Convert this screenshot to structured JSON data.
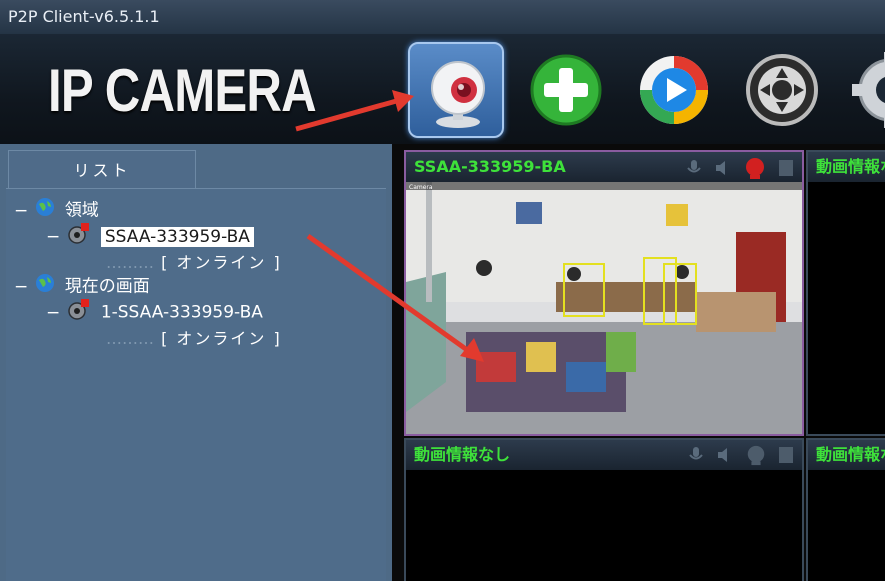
{
  "window": {
    "title": "P2P Client-v6.5.1.1"
  },
  "toolbar": {
    "logo_text": "IP CAMERA",
    "buttons": [
      {
        "icon": "webcam-icon",
        "state": "selected"
      },
      {
        "icon": "add-icon"
      },
      {
        "icon": "playback-icon"
      },
      {
        "icon": "ptz-control-icon"
      },
      {
        "icon": "settings-gear-icon"
      }
    ]
  },
  "sidebar": {
    "tab_label": "リスト",
    "tree": [
      {
        "expander": "−",
        "label": "領域",
        "icon": "globe-icon"
      },
      {
        "expander": "−",
        "label": "SSAA-333959-BA",
        "icon": "camera-device-icon",
        "selected": true
      },
      {
        "status": "[ オンライン ]"
      },
      {
        "expander": "−",
        "label": "現在の画面",
        "icon": "globe-icon"
      },
      {
        "expander": "−",
        "label": "1-SSAA-333959-BA",
        "icon": "camera-device-icon"
      },
      {
        "status": "[ オンライン ]"
      }
    ]
  },
  "video_panels": [
    {
      "title": "SSAA-333959-BA",
      "has_feed": true
    },
    {
      "title": "動画情報なし",
      "has_feed": false
    },
    {
      "title": "動画情報なし",
      "has_feed": false
    },
    {
      "title": "動画情報なし",
      "has_feed": false
    }
  ],
  "feed_overlay": {
    "left_label": "Camera"
  },
  "colors": {
    "panel_title": "#3ee23a",
    "panel_border": "#8a5ca0",
    "annotation_arrow": "#e23a2e"
  }
}
